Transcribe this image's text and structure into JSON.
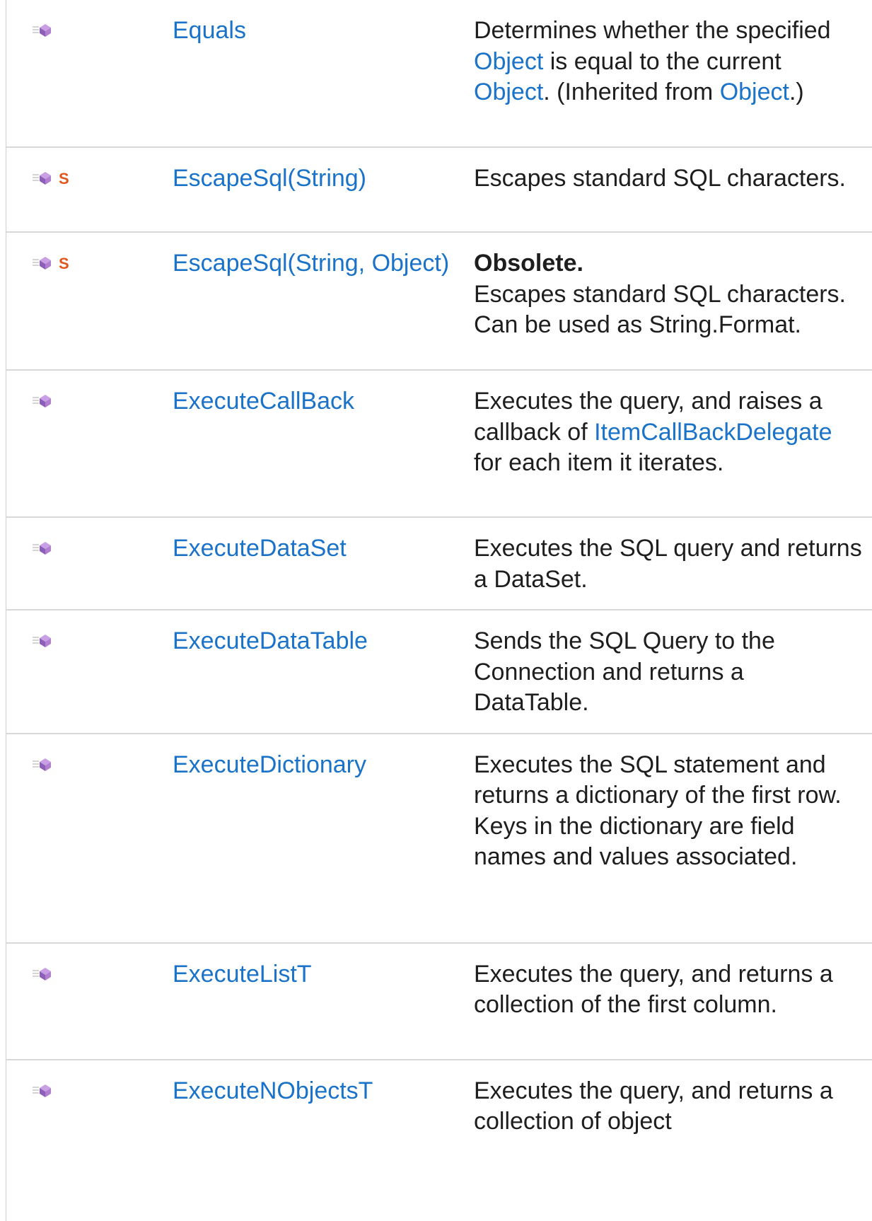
{
  "rows": [
    {
      "name": "Equals",
      "static": false,
      "desc": {
        "p1": "Determines whether the specified ",
        "l1": "Object",
        "p2": " is equal to the current ",
        "l2": "Object",
        "p3": ". (Inherited from ",
        "l3": "Object",
        "p4": ".)"
      }
    },
    {
      "name": "EscapeSql(String)",
      "static": true,
      "desc": "Escapes standard SQL characters."
    },
    {
      "name": "EscapeSql(String, Object)",
      "static": true,
      "obsolete": "Obsolete.",
      "desc": "Escapes standard SQL characters. Can be used as String.Format."
    },
    {
      "name": "ExecuteCallBack",
      "static": false,
      "desc": {
        "p1": "Executes the query, and raises a callback of ",
        "l1": "ItemCallBackDelegate",
        "p2": " for each item it iterates."
      }
    },
    {
      "name": "ExecuteDataSet",
      "static": false,
      "desc": "Executes the SQL query and returns a DataSet."
    },
    {
      "name": "ExecuteDataTable",
      "static": false,
      "desc": "Sends the SQL Query to the Connection and returns a DataTable."
    },
    {
      "name": "ExecuteDictionary",
      "static": false,
      "desc": "Executes the SQL statement and returns a dictionary of the first row. Keys in the dictionary are field names and values associated."
    },
    {
      "name": "ExecuteListT",
      "static": false,
      "desc": "Executes the query, and returns a collection of the first column."
    },
    {
      "name": "ExecuteNObjectsT",
      "static": false,
      "desc": "Executes the query, and returns a collection of object"
    }
  ],
  "icons": {
    "method": "public-method-icon",
    "static": "static-member-icon",
    "colors": {
      "method": "#b07fd0",
      "static": "#e0571b"
    }
  }
}
